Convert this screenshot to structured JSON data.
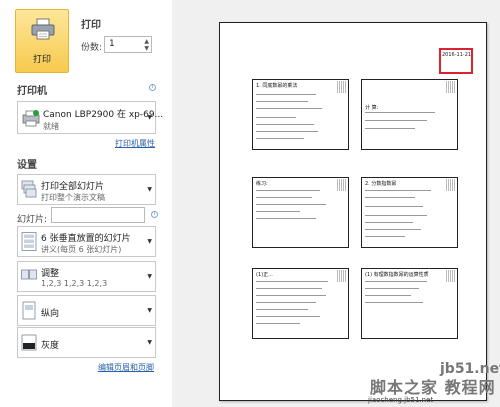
{
  "print": {
    "button_label": "打印",
    "title": "打印",
    "copies_label": "份数:",
    "copies_value": "1"
  },
  "printer": {
    "section_title": "打印机",
    "name": "Canon LBP2900 在 xp-69...",
    "status": "就绪",
    "properties_link": "打印机属性"
  },
  "settings": {
    "section_title": "设置",
    "range": {
      "line1": "打印全部幻灯片",
      "line2": "打印整个演示文稿"
    },
    "slides_label": "幻灯片:",
    "slides_value": "",
    "layout": {
      "line1": "6 张垂直放置的幻灯片",
      "line2": "讲义(每页 6 张幻灯片)"
    },
    "collate": {
      "line1": "调整",
      "line2": "1,2,3    1,2,3    1,2,3"
    },
    "orientation": {
      "label": "纵向"
    },
    "color": {
      "label": "灰度"
    },
    "header_footer_link": "编辑页眉和页脚"
  },
  "preview": {
    "date": "2016-11-21",
    "slides": [
      {
        "heading": "1. 同底数幂的乘法"
      },
      {
        "heading": "计 算:"
      },
      {
        "heading": "练习:"
      },
      {
        "heading": "2. 分数指数幂"
      },
      {
        "heading": "(1)正..."
      },
      {
        "heading": "(1) 有理数指数幂的运算性质"
      }
    ]
  },
  "watermark": {
    "site": "jb51.net",
    "brand": "脚本之家 教程网",
    "url": "jiaocheng.jb51.net"
  }
}
